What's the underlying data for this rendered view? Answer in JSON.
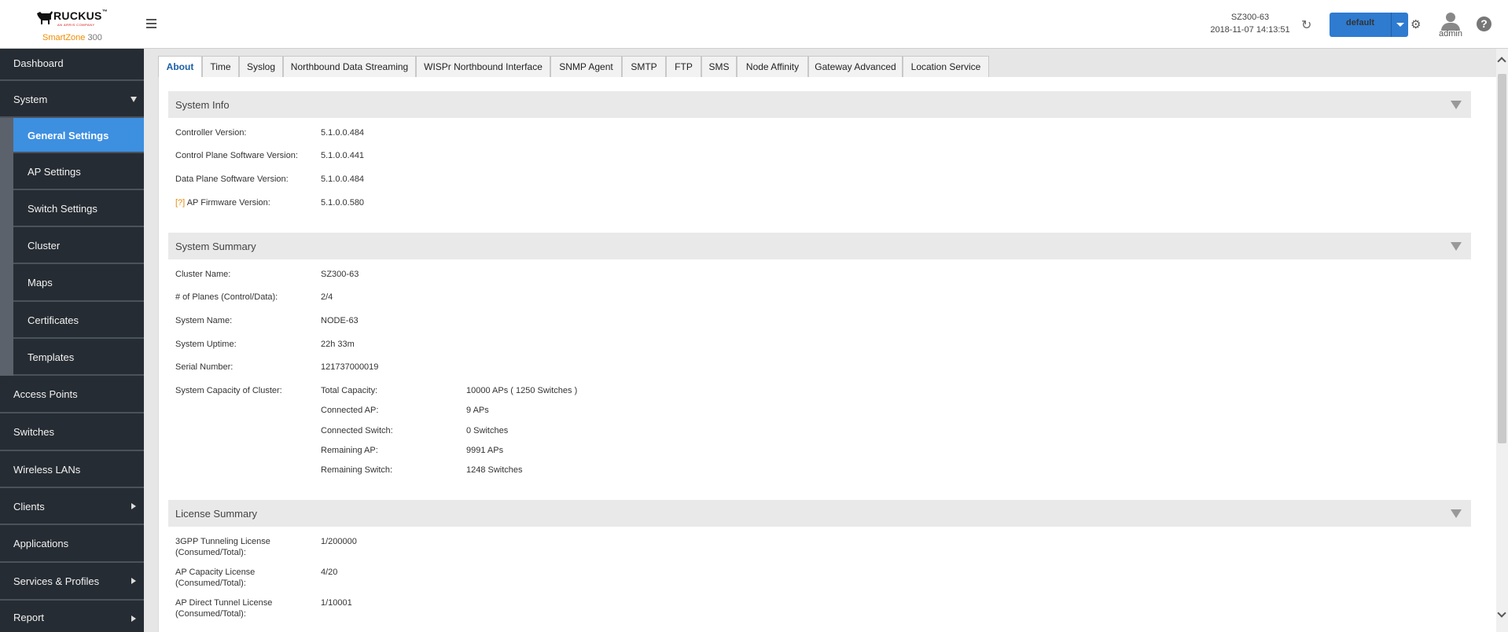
{
  "header": {
    "brand": "RUCKUS",
    "brand_tm": "™",
    "brand_tagline": "AN ARRIS COMPANY",
    "product_name": "SmartZone",
    "product_model": "300",
    "system_name": "SZ300-63",
    "system_time": "2018-11-07  14:13:51",
    "domain_label": "default",
    "user_name": "admin",
    "help_label": "?"
  },
  "sidebar": {
    "dashboard": "Dashboard",
    "system": "System",
    "system_items": [
      "General Settings",
      "AP Settings",
      "Switch Settings",
      "Cluster",
      "Maps",
      "Certificates",
      "Templates"
    ],
    "access_points": "Access Points",
    "switches": "Switches",
    "wireless_lans": "Wireless LANs",
    "clients": "Clients",
    "applications": "Applications",
    "services_profiles": "Services & Profiles",
    "report": "Report"
  },
  "tabs": [
    "About",
    "Time",
    "Syslog",
    "Northbound Data Streaming",
    "WISPr Northbound Interface",
    "SNMP Agent",
    "SMTP",
    "FTP",
    "SMS",
    "Node Affinity",
    "Gateway Advanced",
    "Location Service"
  ],
  "system_info": {
    "title": "System Info",
    "controller_version_label": "Controller Version:",
    "controller_version": "5.1.0.0.484",
    "control_plane_label": "Control Plane Software Version:",
    "control_plane": "5.1.0.0.441",
    "data_plane_label": "Data Plane Software Version:",
    "data_plane": "5.1.0.0.484",
    "ap_fw_help": "[?]",
    "ap_fw_label": "AP Firmware Version:",
    "ap_fw": "5.1.0.0.580"
  },
  "system_summary": {
    "title": "System Summary",
    "cluster_name_label": "Cluster Name:",
    "cluster_name": "SZ300-63",
    "planes_label": "# of Planes (Control/Data):",
    "planes": "2/4",
    "system_name_label": "System Name:",
    "system_name": "NODE-63",
    "uptime_label": "System Uptime:",
    "uptime": "22h 33m",
    "serial_label": "Serial Number:",
    "serial": "121737000019",
    "capacity_label": "System Capacity of Cluster:",
    "total_capacity_label": "Total Capacity:",
    "total_capacity": "10000 APs ( 1250 Switches )",
    "connected_ap_label": "Connected AP:",
    "connected_ap": "9 APs",
    "connected_switch_label": "Connected Switch:",
    "connected_switch": "0 Switches",
    "remaining_ap_label": "Remaining AP:",
    "remaining_ap": "9991 APs",
    "remaining_switch_label": "Remaining Switch:",
    "remaining_switch": "1248 Switches"
  },
  "license_summary": {
    "title": "License Summary",
    "gpp_label_1": "3GPP Tunneling License",
    "gpp_label_2": "(Consumed/Total):",
    "gpp_value": "1/200000",
    "apcap_label_1": "AP Capacity License",
    "apcap_label_2": "(Consumed/Total):",
    "apcap_value": "4/20",
    "apdirect_label_1": "AP Direct Tunnel License",
    "apdirect_label_2": "(Consumed/Total):",
    "apdirect_value": "1/10001"
  }
}
